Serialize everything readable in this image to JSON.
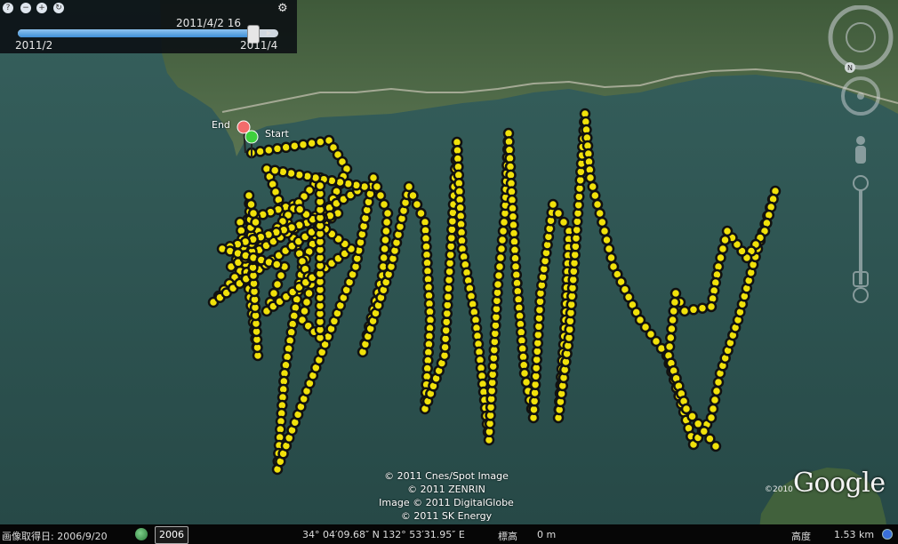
{
  "timeline": {
    "current_time": "2011/4/2  16",
    "range_start": "2011/2",
    "range_end": "2011/4",
    "position_fraction": 0.9
  },
  "toolbar": {
    "buttons": [
      "help-icon",
      "zoom-out-icon",
      "zoom-in-icon",
      "refresh-icon"
    ]
  },
  "markers": {
    "start_label": "Start",
    "end_label": "End",
    "start_color": "#3ecf3e",
    "end_color": "#f26b6b"
  },
  "track": {
    "point_color": "#f1e10a",
    "point_border": "#111111",
    "trail_color": "#e0201c"
  },
  "copyright_lines": [
    "© 2011 Cnes/Spot Image",
    "© 2011 ZENRIN",
    "Image © 2011 DigitalGlobe",
    "© 2011 SK Energy"
  ],
  "logo": {
    "text": "Google",
    "copyright": "©2010"
  },
  "status": {
    "capture_date_label": "画像取得日: 2006/9/20",
    "year_button": "2006",
    "coordinates": "34° 04′09.68″ N 132° 53′31.95″ E",
    "elevation_label": "標高",
    "elevation_value": "0 m",
    "altitude_label": "高度",
    "altitude_value": "1.53 km"
  },
  "colors": {
    "sea": "#2c5150",
    "land": "#4d6a45",
    "status_bg": "#060606"
  }
}
